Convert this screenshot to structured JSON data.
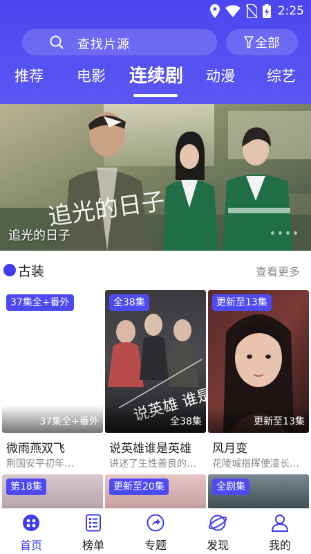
{
  "status_bar": {
    "time": "2:25"
  },
  "search": {
    "placeholder": "查找片源"
  },
  "filter": {
    "label": "全部"
  },
  "tabs": [
    {
      "label": "推荐",
      "active": false
    },
    {
      "label": "电影",
      "active": false
    },
    {
      "label": "连续剧",
      "active": true
    },
    {
      "label": "动漫",
      "active": false
    },
    {
      "label": "综艺",
      "active": false
    }
  ],
  "banner": {
    "caption": "追光的日子",
    "artwork_title": "追光的日子"
  },
  "section": {
    "title": "古装",
    "more": "查看更多"
  },
  "cards": [
    {
      "badge": "37集全+番外",
      "episodes": "37集全+番外",
      "title": "微雨燕双飞",
      "desc": "荆国安平初年…"
    },
    {
      "badge": "全38集",
      "episodes": "全38集",
      "title": "说英雄谁是英雄",
      "desc": "讲述了生性善良的…",
      "poster_text": "说英雄 谁是英雄"
    },
    {
      "badge": "更新至13集",
      "episodes": "更新至13集",
      "title": "风月变",
      "desc": "花陵城指挥使凌长…"
    }
  ],
  "cards_row2": [
    {
      "badge": "第18集"
    },
    {
      "badge": "更新至20集"
    },
    {
      "badge": "全剧集"
    }
  ],
  "bottom_nav": [
    {
      "label": "首页",
      "icon": "home-icon",
      "active": true
    },
    {
      "label": "榜单",
      "icon": "list-icon",
      "active": false
    },
    {
      "label": "专题",
      "icon": "topic-icon",
      "active": false
    },
    {
      "label": "发现",
      "icon": "discover-icon",
      "active": false
    },
    {
      "label": "我的",
      "icon": "profile-icon",
      "active": false
    }
  ],
  "colors": {
    "primary": "#4b46f0",
    "badge": "#4d4af2",
    "text": "#222222",
    "muted": "#8a8a8a"
  }
}
